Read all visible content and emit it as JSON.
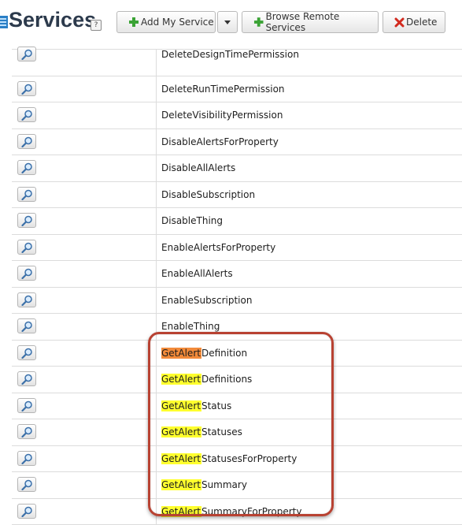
{
  "header": {
    "title": "Services",
    "help_glyph": "?",
    "add_label": "Add My Service",
    "browse_label": "Browse Remote Services",
    "delete_label": "Delete"
  },
  "colors": {
    "search_highlight": "#ffff2e",
    "current_highlight": "#f28a3a",
    "callout": "#b84232"
  },
  "rows": [
    {
      "prefix": "",
      "rest": "DeleteDesignTimePermission"
    },
    {
      "prefix": "",
      "rest": "DeleteRunTimePermission"
    },
    {
      "prefix": "",
      "rest": "DeleteVisibilityPermission"
    },
    {
      "prefix": "",
      "rest": "DisableAlertsForProperty"
    },
    {
      "prefix": "",
      "rest": "DisableAllAlerts"
    },
    {
      "prefix": "",
      "rest": "DisableSubscription"
    },
    {
      "prefix": "",
      "rest": "DisableThing"
    },
    {
      "prefix": "",
      "rest": "EnableAlertsForProperty"
    },
    {
      "prefix": "",
      "rest": "EnableAllAlerts"
    },
    {
      "prefix": "",
      "rest": "EnableSubscription"
    },
    {
      "prefix": "",
      "rest": "EnableThing"
    },
    {
      "prefix": "GetAlert",
      "rest": "Definition",
      "current": true
    },
    {
      "prefix": "GetAlert",
      "rest": "Definitions"
    },
    {
      "prefix": "GetAlert",
      "rest": "Status"
    },
    {
      "prefix": "GetAlert",
      "rest": "Statuses"
    },
    {
      "prefix": "GetAlert",
      "rest": "StatusesForProperty"
    },
    {
      "prefix": "GetAlert",
      "rest": "Summary"
    },
    {
      "prefix": "GetAlert",
      "rest": "SummaryForProperty"
    }
  ]
}
